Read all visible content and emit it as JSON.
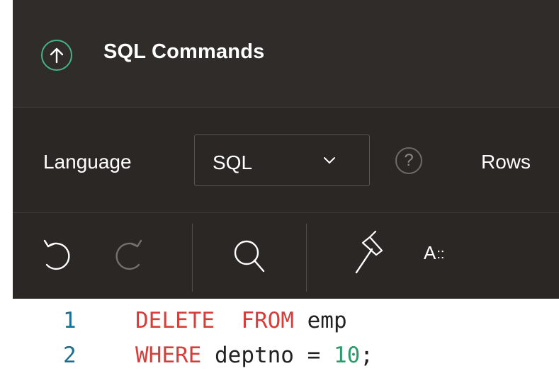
{
  "header": {
    "title": "SQL Commands"
  },
  "language_bar": {
    "language_label": "Language",
    "language_value": "SQL",
    "help_symbol": "?",
    "rows_label": "Rows"
  },
  "toolbar": {
    "format_label": "A",
    "format_suffix": "::"
  },
  "editor": {
    "lines": [
      {
        "number": "1",
        "tokens": [
          {
            "text": "DELETE",
            "kind": "keyword"
          },
          {
            "text": "  ",
            "kind": "space"
          },
          {
            "text": "FROM",
            "kind": "keyword"
          },
          {
            "text": " emp",
            "kind": "plain"
          }
        ]
      },
      {
        "number": "2",
        "tokens": [
          {
            "text": "WHERE",
            "kind": "keyword"
          },
          {
            "text": " deptno = ",
            "kind": "plain"
          },
          {
            "text": "10",
            "kind": "number"
          },
          {
            "text": ";",
            "kind": "plain"
          }
        ]
      }
    ]
  },
  "colors": {
    "panel_background": "#2f2c2a",
    "toolbar_background": "#2a2725",
    "accent_green": "#43b38a",
    "keyword_red": "#d53f3b",
    "number_green": "#2a9b6a",
    "line_number_blue": "#1d6f91"
  },
  "icons": {
    "title": "upload-arrow-circle-icon",
    "chevron": "chevron-down-icon",
    "help": "help-circle-icon",
    "undo": "undo-icon",
    "redo": "redo-icon",
    "search": "search-icon",
    "build": "hammer-icon",
    "format": "text-format-icon"
  }
}
